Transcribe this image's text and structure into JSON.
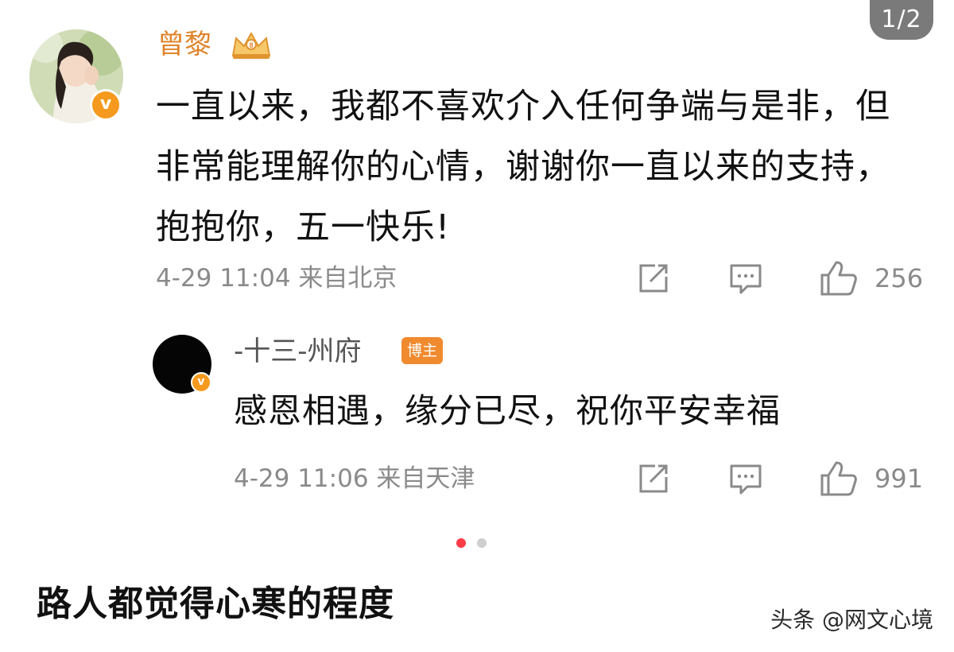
{
  "page_indicator": "1/2",
  "comment": {
    "username": "曾黎",
    "verified_icon": "v-badge-icon",
    "text": "一直以来，我都不喜欢介入任何争端与是非，但非常能理解你的心情，谢谢你一直以来的支持，抱抱你，五一快乐!",
    "meta": "4-29 11:04 来自北京",
    "like_count": "256"
  },
  "reply": {
    "username": "-十三-州府",
    "badge": "博主",
    "verified_icon": "v-badge-icon",
    "text": "感恩相遇，缘分已尽，祝你平安幸福",
    "meta": "4-29 11:06 来自天津",
    "like_count": "991"
  },
  "caption": "路人都觉得心寒的程度",
  "watermark": "头条 @网文心境",
  "colors": {
    "username_orange": "#e0842a",
    "badge_orange": "#f08a2e",
    "dot_active": "#ff3b47",
    "meta_gray": "#8a8a8a"
  }
}
